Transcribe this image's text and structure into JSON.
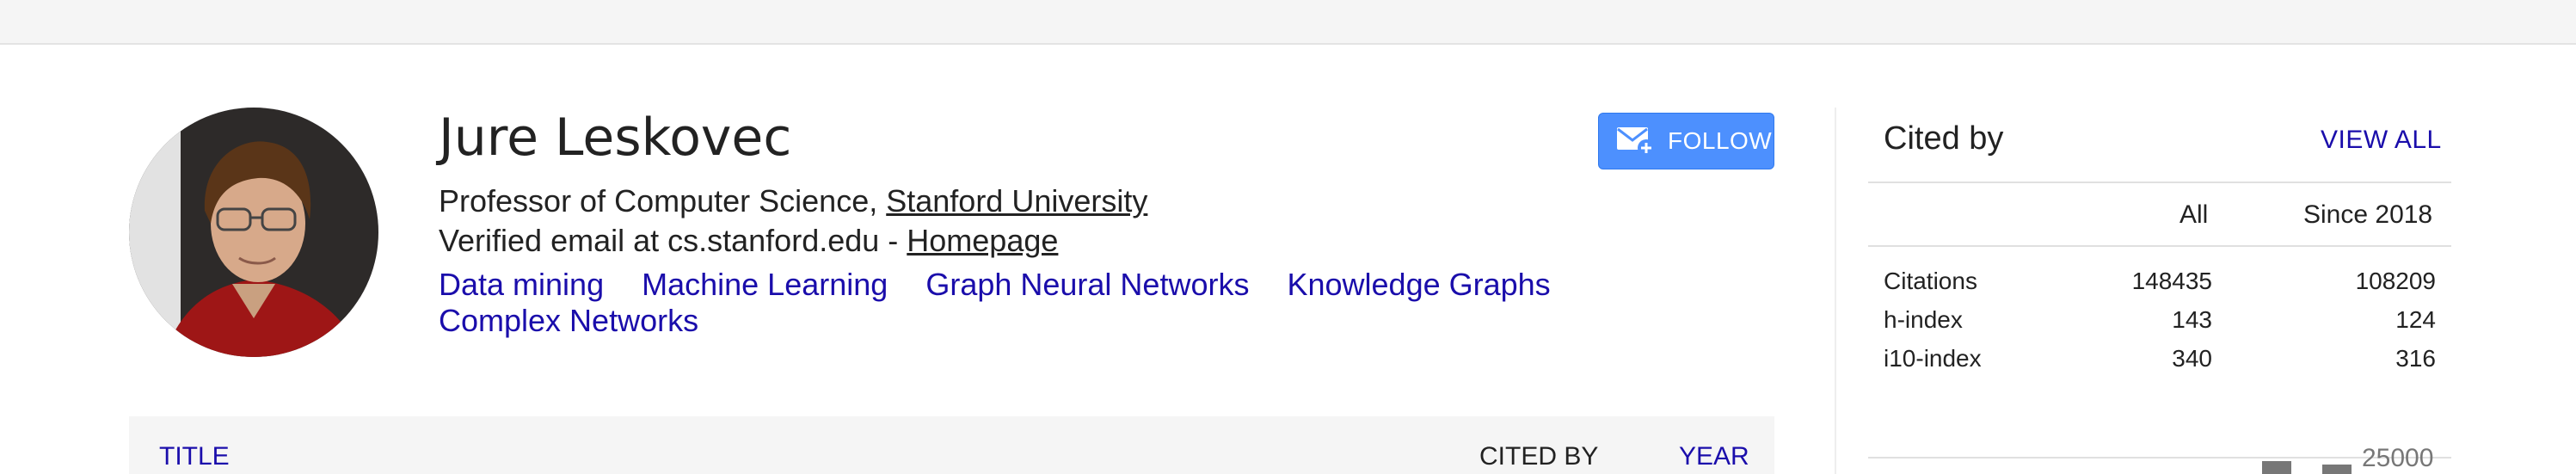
{
  "profile": {
    "name": "Jure Leskovec",
    "affiliation_prefix": "Professor of Computer Science, ",
    "affiliation_link": "Stanford University",
    "email_text": "Verified email at cs.stanford.edu - ",
    "homepage_link": "Homepage",
    "interests": [
      "Data mining",
      "Machine Learning",
      "Graph Neural Networks",
      "Knowledge Graphs",
      "Complex Networks"
    ]
  },
  "follow_button": {
    "label": "FOLLOW",
    "icon": "mail-plus-icon"
  },
  "articles_table": {
    "col_title": "TITLE",
    "col_cited_by": "CITED BY",
    "col_year": "YEAR"
  },
  "cited_by": {
    "title": "Cited by",
    "view_all": "VIEW ALL",
    "headers": {
      "all": "All",
      "since": "Since 2018"
    },
    "rows": [
      {
        "label": "Citations",
        "all": "148435",
        "since": "108209"
      },
      {
        "label": "h-index",
        "all": "143",
        "since": "124"
      },
      {
        "label": "i10-index",
        "all": "340",
        "since": "316"
      }
    ],
    "chart_axis_label": "25000"
  },
  "colors": {
    "link": "#1a0dab",
    "follow_bg": "#4d90fe",
    "bar": "#777777"
  }
}
